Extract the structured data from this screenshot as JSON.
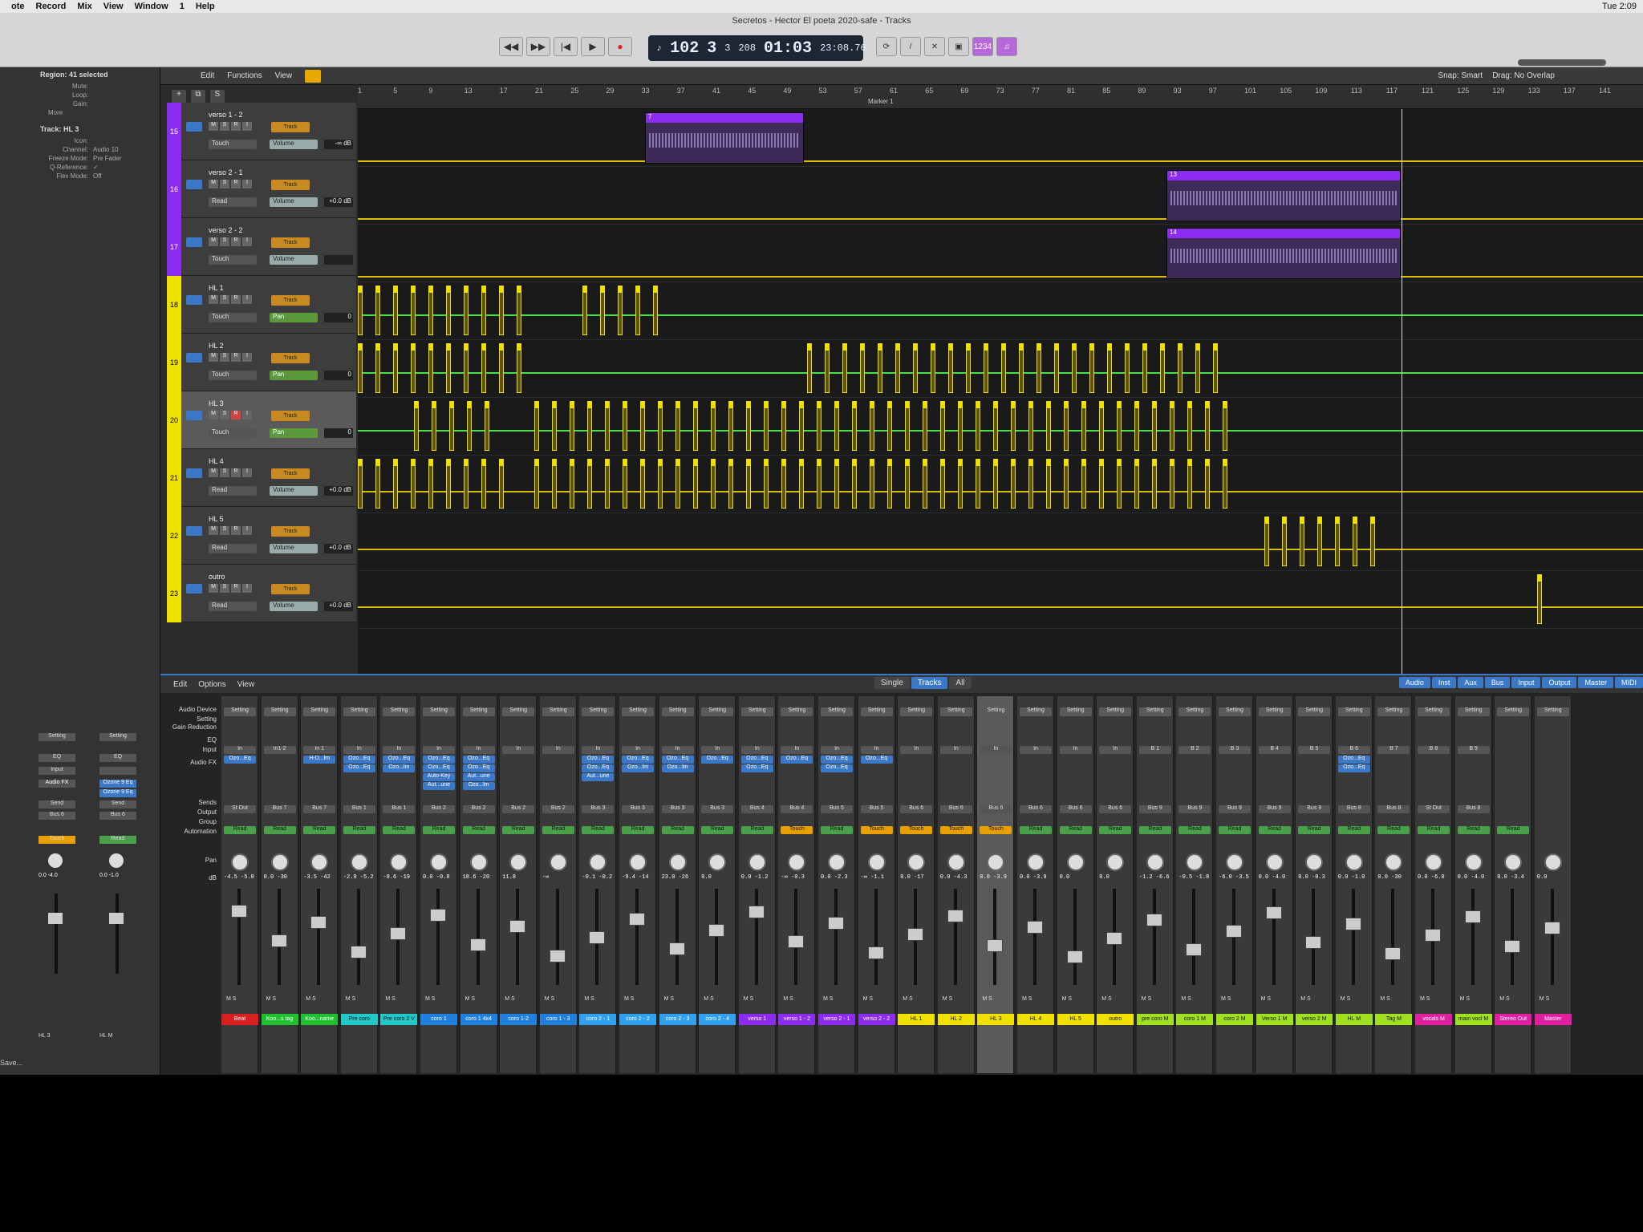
{
  "menubar": {
    "items": [
      "ote",
      "Record",
      "Mix",
      "View",
      "Window",
      "1",
      "Help"
    ],
    "clock": "Tue 2:09"
  },
  "window": {
    "title": "Secretos - Hector El poeta 2020-safe - Tracks"
  },
  "lcd": {
    "tempo": "102",
    "bar": "3",
    "beat": "3",
    "div": "208",
    "time": "01:03",
    "frames": "23:08.76"
  },
  "modes": {
    "count_in": "1234"
  },
  "inspector": {
    "region_title": "Region: 41 selected",
    "region_rows": [
      {
        "k": "Mute:",
        "v": ""
      },
      {
        "k": "Loop:",
        "v": ""
      },
      {
        "k": "Gain:",
        "v": ""
      }
    ],
    "more": "More",
    "track_title": "Track: HL 3",
    "track_rows": [
      {
        "k": "Icon:",
        "v": ""
      },
      {
        "k": "Channel:",
        "v": "Audio 10"
      },
      {
        "k": "Freeze Mode:",
        "v": "Pre Fader"
      },
      {
        "k": "Q-Reference:",
        "v": "✓"
      },
      {
        "k": "Flex Mode:",
        "v": "Off"
      }
    ],
    "strips": [
      {
        "setting": "Setting",
        "eq": "EQ",
        "input": "Input",
        "fx": [
          "Audio FX"
        ],
        "send": "Send",
        "out": "Bus 6",
        "mode": "Touch",
        "db": "0.0  -4.0",
        "name": "HL 3"
      },
      {
        "setting": "Setting",
        "eq": "EQ",
        "input": "",
        "fx": [
          "Ozone 9 Eq",
          "Ozone 9 Eq"
        ],
        "send": "Send",
        "out": "Bus 6",
        "mode": "Read",
        "db": "0.0  -1.0",
        "name": "HL M"
      }
    ],
    "save": "Save..."
  },
  "tracks_toolbar": {
    "edit": "Edit",
    "functions": "Functions",
    "view": "View",
    "snap": "Snap:",
    "snap_val": "Smart",
    "drag": "Drag:",
    "drag_val": "No Overlap"
  },
  "ruler": {
    "ticks": [
      "1",
      "5",
      "9",
      "13",
      "17",
      "21",
      "25",
      "29",
      "33",
      "37",
      "41",
      "45",
      "49",
      "53",
      "57",
      "61",
      "65",
      "69",
      "73",
      "77",
      "81",
      "85",
      "89",
      "93",
      "97",
      "101",
      "105",
      "109",
      "113",
      "117",
      "121",
      "125",
      "129",
      "133",
      "137",
      "141"
    ],
    "marker": "Marker 1"
  },
  "tracks": [
    {
      "num": "15",
      "name": "verso 1 - 2",
      "mode": "Touch",
      "param": "Volume",
      "val": "-∞ dB",
      "color": "#8c2cf0"
    },
    {
      "num": "16",
      "name": "verso 2 - 1",
      "mode": "Read",
      "param": "Volume",
      "val": "+0.0 dB",
      "color": "#8c2cf0"
    },
    {
      "num": "17",
      "name": "verso 2 - 2",
      "mode": "Touch",
      "param": "Volume",
      "val": "",
      "color": "#8c2cf0"
    },
    {
      "num": "18",
      "name": "HL 1",
      "mode": "Touch",
      "param": "Pan",
      "val": "0",
      "color": "#f0e000"
    },
    {
      "num": "19",
      "name": "HL 2",
      "mode": "Touch",
      "param": "Pan",
      "val": "0",
      "color": "#f0e000"
    },
    {
      "num": "20",
      "name": "HL 3",
      "mode": "Touch",
      "param": "Pan",
      "val": "0",
      "color": "#f0e000"
    },
    {
      "num": "21",
      "name": "HL 4",
      "mode": "Read",
      "param": "Volume",
      "val": "+0.0 dB",
      "color": "#f0e000"
    },
    {
      "num": "22",
      "name": "HL 5",
      "mode": "Read",
      "param": "Volume",
      "val": "+0.0 dB",
      "color": "#f0e000"
    },
    {
      "num": "23",
      "name": "outro",
      "mode": "Read",
      "param": "Volume",
      "val": "+0.0 dB",
      "color": "#f0e000"
    }
  ],
  "track_labels": {
    "m": "M",
    "s": "S",
    "r": "R",
    "i": "I",
    "track_btn": "Track"
  },
  "regions": {
    "v12": "7",
    "v21": "13",
    "v22": "14"
  },
  "mixer": {
    "edit": "Edit",
    "options": "Options",
    "view": "View",
    "views": [
      "Single",
      "Tracks",
      "All"
    ],
    "filters": [
      "Audio",
      "Inst",
      "Aux",
      "Bus",
      "Input",
      "Output",
      "Master",
      "MIDI"
    ],
    "row_labels": [
      "Audio Device",
      "Setting",
      "Gain Reduction",
      "EQ",
      "Input",
      "Audio FX",
      "Sends",
      "Output",
      "Group",
      "Automation",
      "Pan",
      "dB"
    ],
    "device_val": "0",
    "strips": [
      {
        "name": "Beat",
        "input": "In",
        "fx": [
          "Ozo...Eq"
        ],
        "out": "St Out",
        "mode": "Read",
        "db": "-4.5 -5.0",
        "color": "#d82020"
      },
      {
        "name": "Koo...s tag",
        "input": "In1-2",
        "fx": [],
        "out": "Bus 7",
        "mode": "Read",
        "db": "0.0 -30",
        "color": "#20c030"
      },
      {
        "name": "Koo...name",
        "input": "In 1",
        "fx": [
          "H-D...lm"
        ],
        "out": "Bus 7",
        "mode": "Read",
        "db": "-3.5 -42",
        "color": "#20c030"
      },
      {
        "name": "Pre coro",
        "input": "In",
        "fx": [
          "Ozo...Eq",
          "Ozo...Eq"
        ],
        "out": "Bus 1",
        "mode": "Read",
        "db": "-2.9 -5.2",
        "color": "#20c8c8"
      },
      {
        "name": "Pre coro 2 V",
        "input": "In",
        "fx": [
          "Ozo...Eq",
          "Ozo...lm"
        ],
        "out": "Bus 1",
        "mode": "Read",
        "db": "-8.6 -19",
        "color": "#20c8c8"
      },
      {
        "name": "coro 1",
        "input": "In",
        "fx": [
          "Ozo...Eq",
          "Ozo...Eq",
          "Auto-Key",
          "Aut...une"
        ],
        "out": "Bus 2",
        "mode": "Read",
        "db": "0.0 -0.8",
        "color": "#2080e0"
      },
      {
        "name": "coro 1 4x4",
        "input": "In",
        "fx": [
          "Ozo...Eq",
          "Ozo...Eq",
          "Aut...une",
          "Ozo...lm"
        ],
        "out": "Bus 2",
        "mode": "Read",
        "db": "18.6 -20",
        "color": "#2080e0"
      },
      {
        "name": "coro 1-2",
        "input": "In",
        "fx": [],
        "out": "Bus 2",
        "mode": "Read",
        "db": "11.8",
        "color": "#2080e0"
      },
      {
        "name": "coro 1 - 3",
        "input": "In",
        "fx": [],
        "out": "Bus 2",
        "mode": "Read",
        "db": "-∞",
        "color": "#2080e0"
      },
      {
        "name": "coro 2 - 1",
        "input": "In",
        "fx": [
          "Ozo...Eq",
          "Ozo...Eq",
          "Aut...une"
        ],
        "out": "Bus 3",
        "mode": "Read",
        "db": "-0.1 -0.2",
        "color": "#30a0f0"
      },
      {
        "name": "coro 2 - 2",
        "input": "In",
        "fx": [
          "Ozo...Eq",
          "Ozo...lm"
        ],
        "out": "Bus 3",
        "mode": "Read",
        "db": "-9.4 -14",
        "color": "#30a0f0"
      },
      {
        "name": "coro 2 - 3",
        "input": "In",
        "fx": [
          "Ozo...Eq",
          "Ozo...lm"
        ],
        "out": "Bus 3",
        "mode": "Read",
        "db": "23.0 -26",
        "color": "#30a0f0"
      },
      {
        "name": "coro 2 - 4",
        "input": "In",
        "fx": [
          "Ozo...Eq"
        ],
        "out": "Bus 3",
        "mode": "Read",
        "db": "0.0",
        "color": "#30a0f0"
      },
      {
        "name": "verso 1",
        "input": "In",
        "fx": [
          "Ozo...Eq",
          "Ozo...Eq"
        ],
        "out": "Bus 4",
        "mode": "Read",
        "db": "0.0 -1.2",
        "color": "#8c2cf0"
      },
      {
        "name": "verso 1 - 2",
        "input": "In",
        "fx": [
          "Ozo...Eq"
        ],
        "out": "Bus 4",
        "mode": "Touch",
        "db": "-∞ -0.3",
        "color": "#8c2cf0"
      },
      {
        "name": "verso 2 - 1",
        "input": "In",
        "fx": [
          "Ozo...Eq",
          "Ozo...Eq"
        ],
        "out": "Bus 5",
        "mode": "Read",
        "db": "0.0 -2.3",
        "color": "#8c2cf0"
      },
      {
        "name": "verso 2 - 2",
        "input": "In",
        "fx": [
          "Ozo...Eq"
        ],
        "out": "Bus 5",
        "mode": "Touch",
        "db": "-∞ -1.1",
        "color": "#8c2cf0"
      },
      {
        "name": "HL 1",
        "input": "In",
        "fx": [],
        "out": "Bus 6",
        "mode": "Touch",
        "db": "0.0 -17",
        "color": "#f0e000"
      },
      {
        "name": "HL 2",
        "input": "In",
        "fx": [],
        "out": "Bus 6",
        "mode": "Touch",
        "db": "0.0 -4.3",
        "color": "#f0e000"
      },
      {
        "name": "HL 3",
        "input": "In",
        "fx": [],
        "out": "Bus 6",
        "mode": "Touch",
        "db": "0.0 -3.9",
        "color": "#f0e000"
      },
      {
        "name": "HL 4",
        "input": "In",
        "fx": [],
        "out": "Bus 6",
        "mode": "Read",
        "db": "0.0 -3.9",
        "color": "#f0e000"
      },
      {
        "name": "HL 5",
        "input": "In",
        "fx": [],
        "out": "Bus 6",
        "mode": "Read",
        "db": "0.0",
        "color": "#f0e000"
      },
      {
        "name": "outro",
        "input": "In",
        "fx": [],
        "out": "Bus 6",
        "mode": "Read",
        "db": "0.0",
        "color": "#f0e000"
      },
      {
        "name": "pre coro M",
        "input": "B 1",
        "fx": [],
        "out": "Bus 9",
        "mode": "Read",
        "db": "-1.2 -6.6",
        "color": "#a0e020"
      },
      {
        "name": "coro 1 M",
        "input": "B 2",
        "fx": [],
        "out": "Bus 9",
        "mode": "Read",
        "db": "-0.5 -1.8",
        "color": "#a0e020"
      },
      {
        "name": "coro 2 M",
        "input": "B 3",
        "fx": [],
        "out": "Bus 9",
        "mode": "Read",
        "db": "-6.0 -3.5",
        "color": "#a0e020"
      },
      {
        "name": "Verso 1 M",
        "input": "B 4",
        "fx": [],
        "out": "Bus 9",
        "mode": "Read",
        "db": "0.0 -4.0",
        "color": "#a0e020"
      },
      {
        "name": "verso 2 M",
        "input": "B 5",
        "fx": [],
        "out": "Bus 9",
        "mode": "Read",
        "db": "0.0 -0.3",
        "color": "#a0e020"
      },
      {
        "name": "HL M",
        "input": "B 6",
        "fx": [
          "Ozo...Eq",
          "Ozo...Eq"
        ],
        "out": "Bus 8",
        "mode": "Read",
        "db": "0.0 -1.0",
        "color": "#a0e020"
      },
      {
        "name": "Tag M",
        "input": "B 7",
        "fx": [],
        "out": "Bus 8",
        "mode": "Read",
        "db": "0.0 -30",
        "color": "#a0e020"
      },
      {
        "name": "vocals M",
        "input": "B 8",
        "fx": [],
        "out": "St Out",
        "mode": "Read",
        "db": "0.0 -6.0",
        "color": "#e020a0"
      },
      {
        "name": "main vocl M",
        "input": "B 9",
        "fx": [],
        "out": "Bus 8",
        "mode": "Read",
        "db": "0.0 -4.0",
        "color": "#a0e020"
      },
      {
        "name": "Stereo Out",
        "input": "",
        "fx": [],
        "out": "",
        "mode": "Read",
        "db": "0.0 -3.4",
        "color": "#e020a0"
      },
      {
        "name": "Master",
        "input": "",
        "fx": [],
        "out": "",
        "mode": "",
        "db": "0.0",
        "color": "#e020a0"
      }
    ]
  }
}
